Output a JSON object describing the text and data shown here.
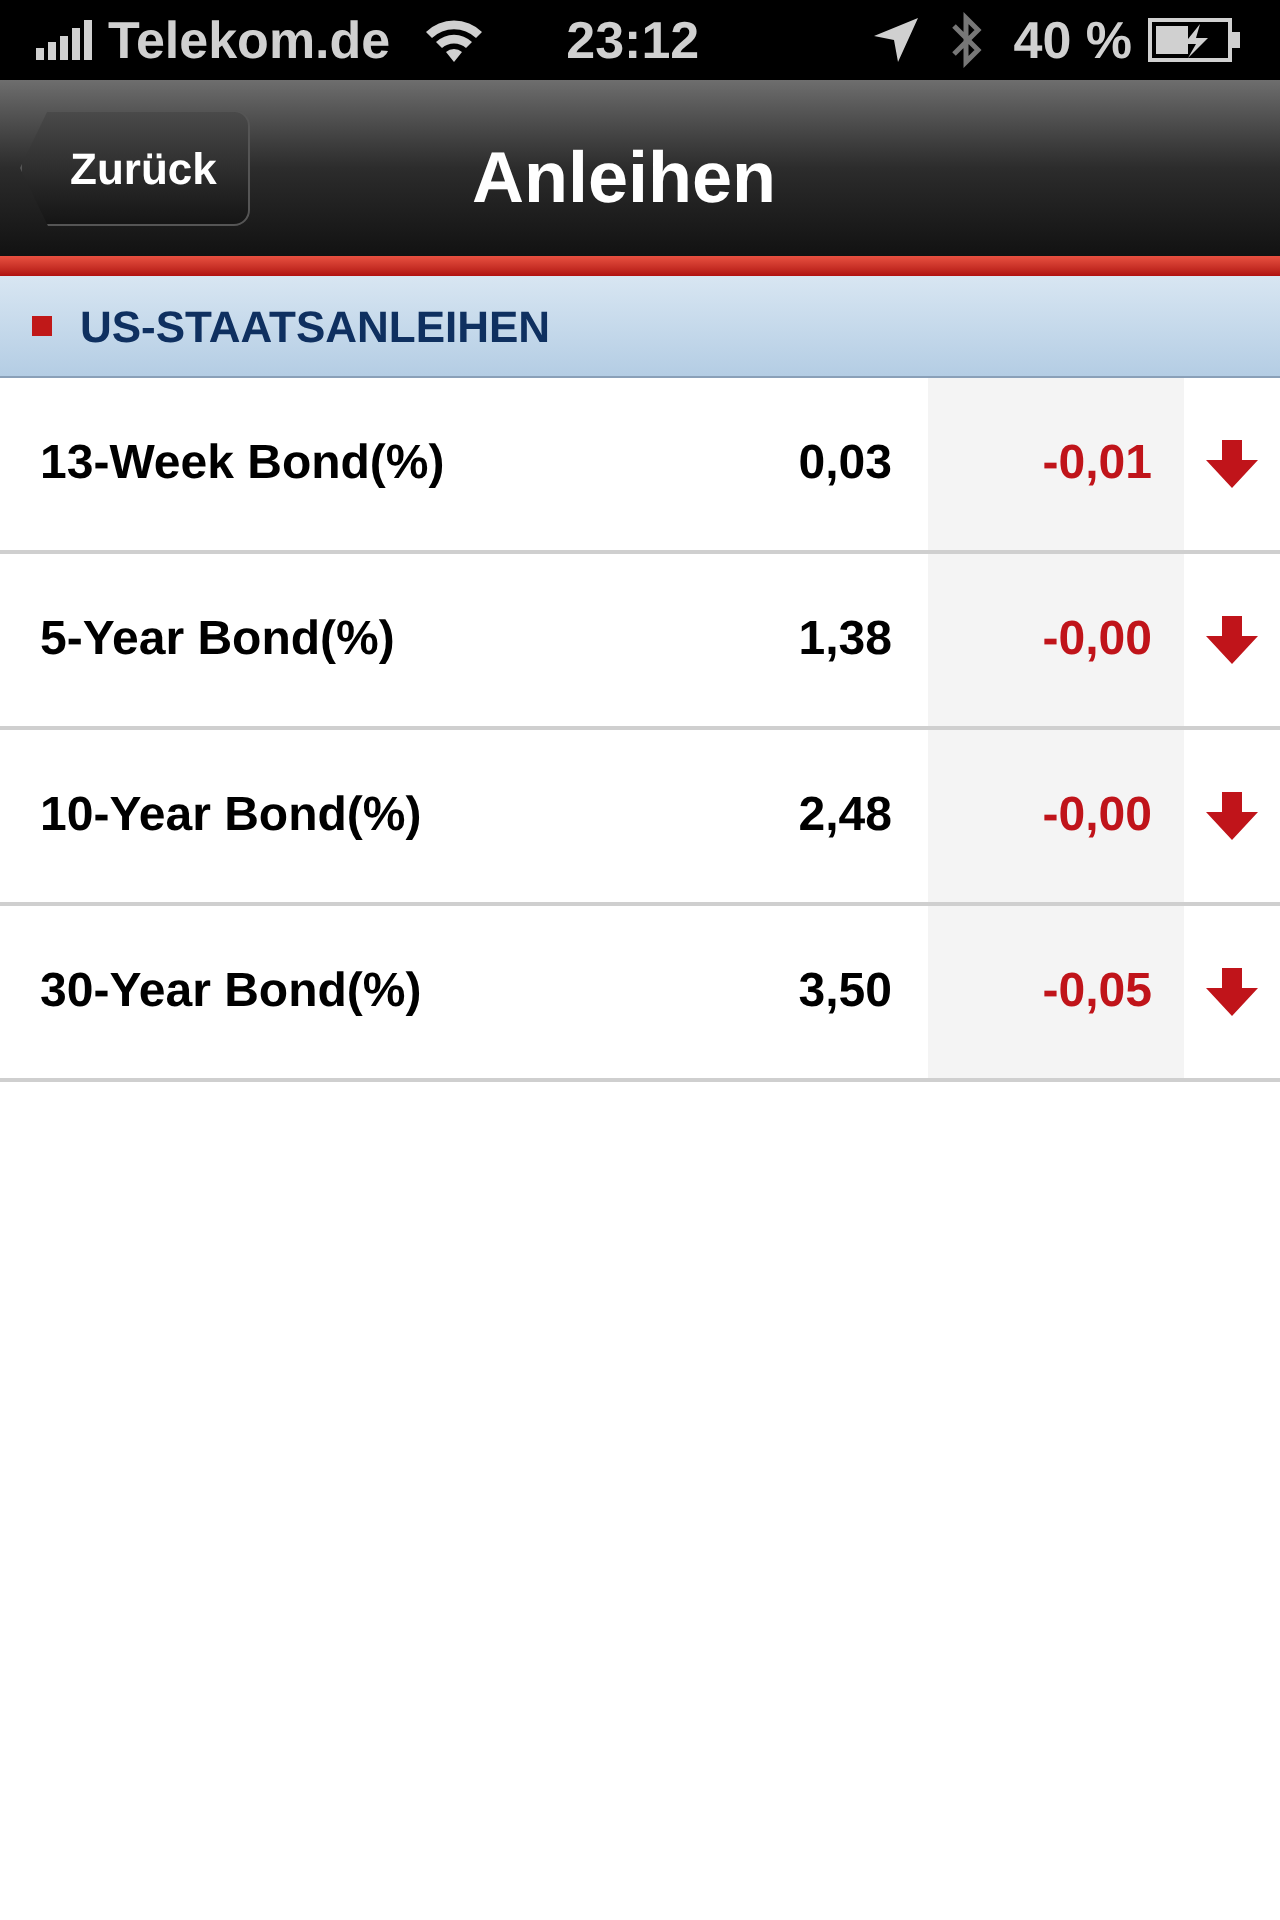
{
  "status_bar": {
    "carrier": "Telekom.de",
    "time": "23:12",
    "battery": "40 %"
  },
  "nav_bar": {
    "back": "Zurück",
    "title": "Anleihen"
  },
  "section": {
    "title": "US-STAATSANLEIHEN"
  },
  "rows": [
    {
      "name": "13-Week Bond(%)",
      "value": "0,03",
      "change": "-0,01",
      "kind": "down"
    },
    {
      "name": "5-Year Bond(%)",
      "value": "1,38",
      "change": "-0,00",
      "kind": "down"
    },
    {
      "name": "10-Year Bond(%)",
      "value": "2,48",
      "change": "-0,00",
      "kind": "down"
    },
    {
      "name": "30-Year Bond(%)",
      "value": "3,50",
      "change": "-0,05",
      "kind": "down"
    }
  ]
}
